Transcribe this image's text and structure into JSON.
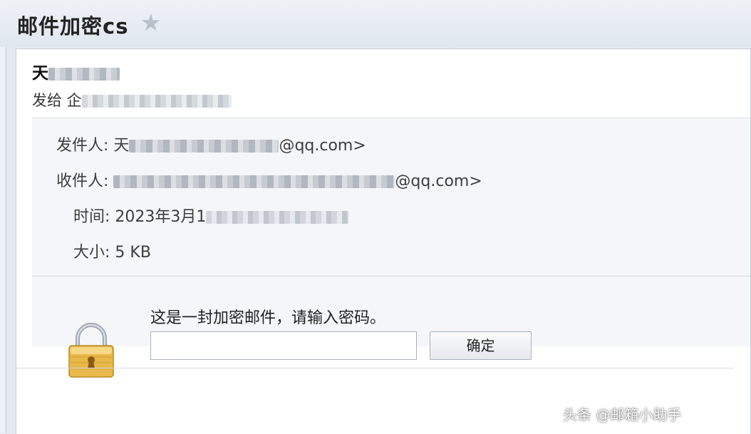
{
  "window": {
    "title": "邮件加密cs",
    "star_icon": "star-icon"
  },
  "message": {
    "subject": "天",
    "sent_to_prefix": "发给 企"
  },
  "details": {
    "from_label": "发件人:",
    "from_lead": "天",
    "from_suffix": "@qq.com>",
    "to_label": "收件人:",
    "to_suffix": "@qq.com>",
    "time_label": "时间:",
    "time_value": "2023年3月1",
    "size_label": "大小:",
    "size_value": "5 KB"
  },
  "encryption": {
    "prompt": "这是一封加密邮件，请输入密码。",
    "password_value": "",
    "password_placeholder": "",
    "confirm_label": "确定",
    "lock_icon": "lock-icon"
  },
  "watermark": {
    "text": "头条 @邮箱小助手"
  },
  "colors": {
    "title_bar": "#e4e9f0",
    "panel": "#ffffff",
    "info_bg": "#f4f6f9",
    "lock_gold": "#e9b84a"
  }
}
